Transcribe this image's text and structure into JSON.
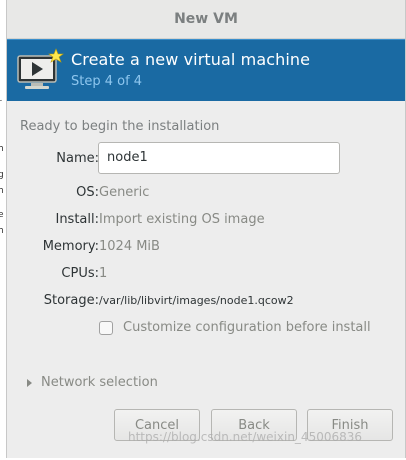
{
  "window": {
    "title": "New VM"
  },
  "banner": {
    "title": "Create a new virtual machine",
    "step": "Step 4 of 4",
    "icon": "monitor-play-new-icon"
  },
  "summary": {
    "heading": "Ready to begin the installation",
    "name_label": "Name:",
    "name_value": "node1",
    "os_label": "OS:",
    "os_value": "Generic",
    "install_label": "Install:",
    "install_value": "Import existing OS image",
    "memory_label": "Memory:",
    "memory_value": "1024 MiB",
    "cpus_label": "CPUs:",
    "cpus_value": "1",
    "storage_label": "Storage:",
    "storage_value": "/var/lib/libvirt/images/node1.qcow2",
    "customize_label": "Customize configuration before install",
    "customize_checked": false
  },
  "network": {
    "label": "Network selection",
    "expanded": false
  },
  "buttons": {
    "cancel": "Cancel",
    "back": "Back",
    "finish": "Finish"
  },
  "watermark": "https://blog.csdn.net/weixin_45006836",
  "colors": {
    "banner": "#1a6aa3",
    "banner_subtitle": "#8ec6ee",
    "window_bg": "#ededed"
  }
}
